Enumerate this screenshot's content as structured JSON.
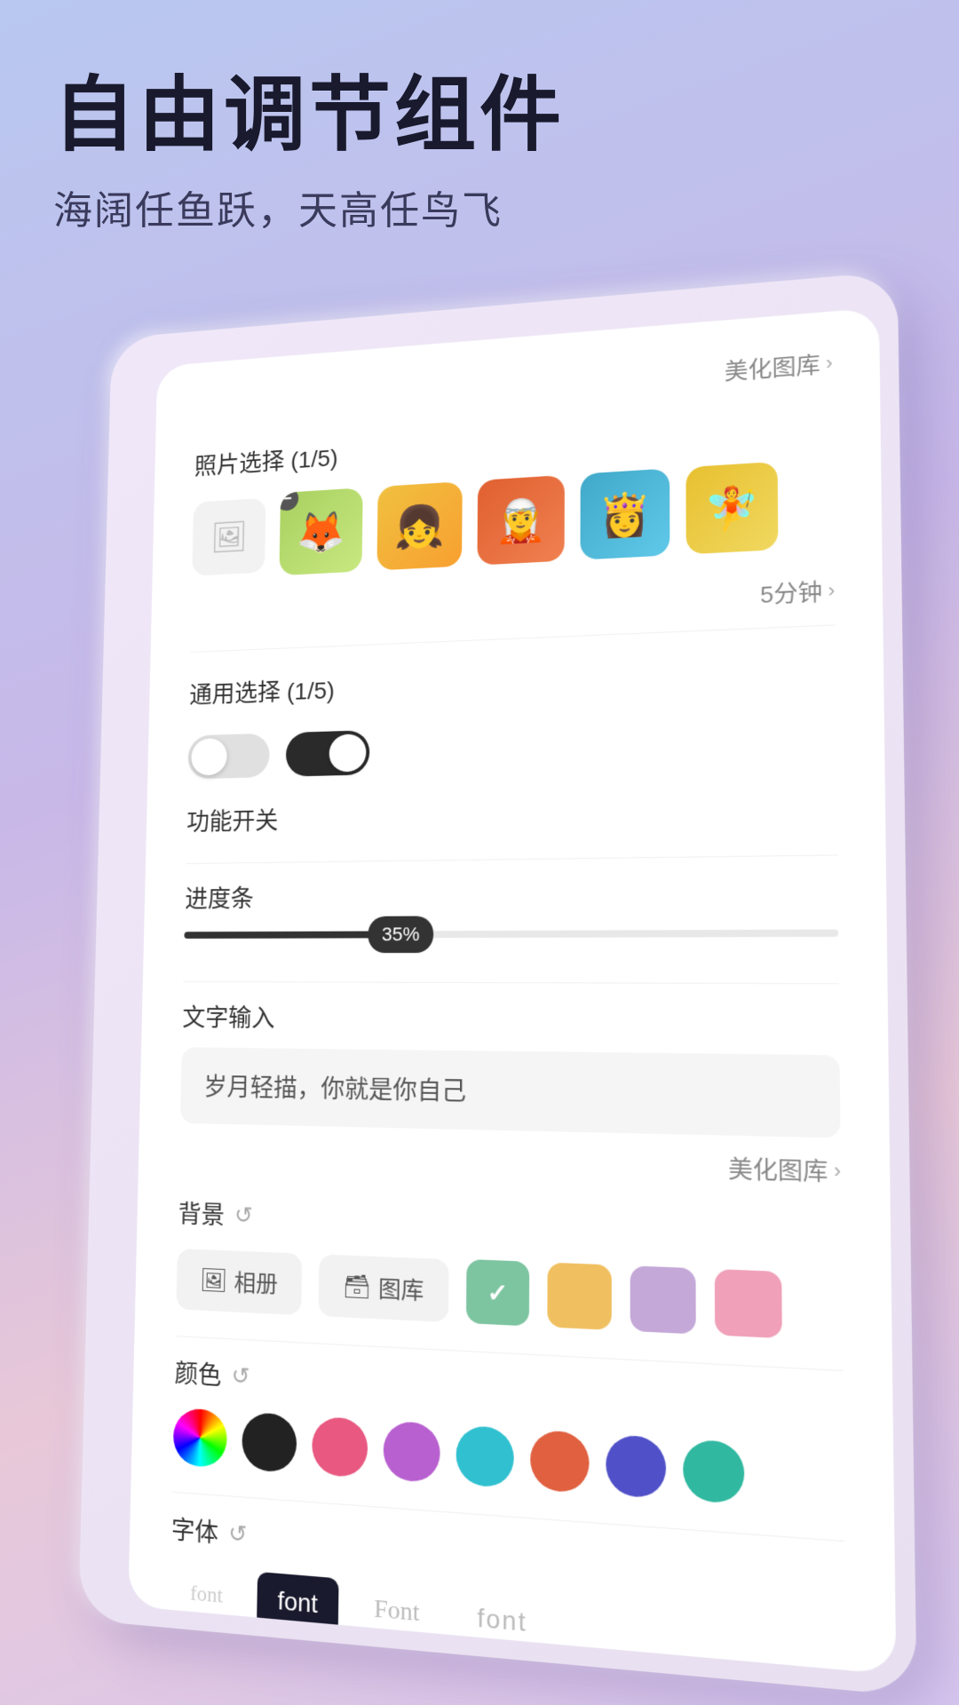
{
  "hero": {
    "title": "自由调节组件",
    "subtitle": "海阔任鱼跃，天高任鸟飞"
  },
  "card": {
    "beautify_link": "美化图库",
    "photo_section": {
      "label": "照片选择 (1/5)",
      "photos": [
        "🦊",
        "👧",
        "🧝",
        "👸",
        "🧚"
      ]
    },
    "timer": {
      "text": "5分钟",
      "chevron": "›"
    },
    "general_section": {
      "label": "通用选择 (1/5)"
    },
    "func_section": {
      "label": "功能开关"
    },
    "progress_section": {
      "label": "进度条",
      "value": "35%",
      "percent": 35
    },
    "text_input": {
      "label": "文字输入",
      "placeholder": "岁月轻描，你就是你自己",
      "beautify_link": "美化图库"
    },
    "background": {
      "label": "背景",
      "album_btn": "相册",
      "gallery_btn": "图库",
      "colors": [
        {
          "color": "#7dc4a0",
          "selected": true
        },
        {
          "color": "#f0c060",
          "selected": false
        },
        {
          "color": "#c4a8d8",
          "selected": false
        },
        {
          "color": "#f0a0b8",
          "selected": false
        }
      ]
    },
    "color_section": {
      "label": "颜色",
      "colors": [
        {
          "type": "wheel"
        },
        {
          "color": "#222222"
        },
        {
          "color": "#e85880"
        },
        {
          "color": "#b860d0"
        },
        {
          "color": "#30c0d0"
        },
        {
          "color": "#e06040"
        },
        {
          "color": "#5050c8"
        },
        {
          "color": "#30b8a0"
        }
      ]
    },
    "font_section": {
      "label": "字体",
      "fonts": [
        {
          "name": "font",
          "style": "serif",
          "active": false
        },
        {
          "name": "font",
          "style": "sans",
          "active": true
        },
        {
          "name": "Font",
          "style": "script",
          "active": false
        },
        {
          "name": "font",
          "style": "light",
          "active": false
        }
      ]
    }
  }
}
